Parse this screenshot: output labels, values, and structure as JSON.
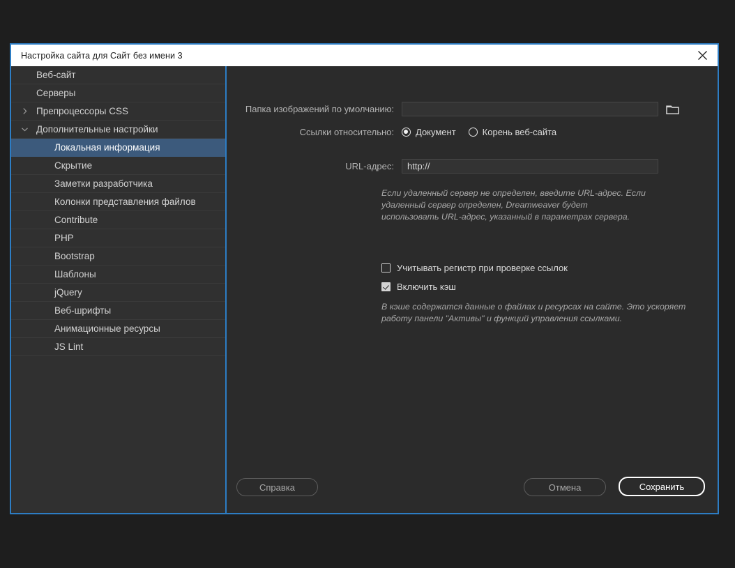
{
  "window": {
    "title": "Настройка сайта для Сайт без имени 3",
    "close_icon": "close-icon"
  },
  "sidebar": {
    "items": [
      {
        "label": "Веб-сайт",
        "level": 0,
        "twisty": "none",
        "selected": false
      },
      {
        "label": "Серверы",
        "level": 0,
        "twisty": "none",
        "selected": false
      },
      {
        "label": "Препроцессоры CSS",
        "level": 0,
        "twisty": "collapsed",
        "selected": false
      },
      {
        "label": "Дополнительные настройки",
        "level": 0,
        "twisty": "expanded",
        "selected": false
      },
      {
        "label": "Локальная информация",
        "level": 1,
        "twisty": "none",
        "selected": true
      },
      {
        "label": "Скрытие",
        "level": 1,
        "twisty": "none",
        "selected": false
      },
      {
        "label": "Заметки разработчика",
        "level": 1,
        "twisty": "none",
        "selected": false
      },
      {
        "label": "Колонки представления файлов",
        "level": 1,
        "twisty": "none",
        "selected": false
      },
      {
        "label": "Contribute",
        "level": 1,
        "twisty": "none",
        "selected": false
      },
      {
        "label": "PHP",
        "level": 1,
        "twisty": "none",
        "selected": false
      },
      {
        "label": "Bootstrap",
        "level": 1,
        "twisty": "none",
        "selected": false
      },
      {
        "label": "Шаблоны",
        "level": 1,
        "twisty": "none",
        "selected": false
      },
      {
        "label": "jQuery",
        "level": 1,
        "twisty": "none",
        "selected": false
      },
      {
        "label": "Веб-шрифты",
        "level": 1,
        "twisty": "none",
        "selected": false
      },
      {
        "label": "Анимационные ресурсы",
        "level": 1,
        "twisty": "none",
        "selected": false
      },
      {
        "label": "JS Lint",
        "level": 1,
        "twisty": "none",
        "selected": false
      }
    ]
  },
  "form": {
    "images_folder": {
      "label": "Папка изображений по умолчанию:",
      "value": "",
      "placeholder": "",
      "browse_icon": "folder-icon"
    },
    "links_relative": {
      "label": "Ссылки относительно:",
      "options": [
        {
          "label": "Документ",
          "checked": true
        },
        {
          "label": "Корень веб-сайта",
          "checked": false
        }
      ]
    },
    "url": {
      "label": "URL-адрес:",
      "value": "http://"
    },
    "url_hint": "Если удаленный сервер не определен, введите URL-адрес. Если удаленный сервер определен, Dreamweaver будет использовать URL-адрес, указанный в параметрах сервера.",
    "case_sensitive": {
      "label": "Учитывать регистр при проверке ссылок",
      "checked": false
    },
    "enable_cache": {
      "label": "Включить кэш",
      "checked": true
    },
    "cache_hint": "В кэше содержатся данные о файлах и ресурсах на сайте. Это ускоряет работу панели \"Активы\" и функций управления ссылками."
  },
  "footer": {
    "help": "Справка",
    "cancel": "Отмена",
    "save": "Сохранить"
  },
  "colors": {
    "accent_border": "#2d7dc4",
    "dialog_bg": "#2b2b2b",
    "sidebar_bg": "#303030",
    "selection_bg": "#3c5a7c",
    "titlebar_bg": "#ffffff"
  }
}
